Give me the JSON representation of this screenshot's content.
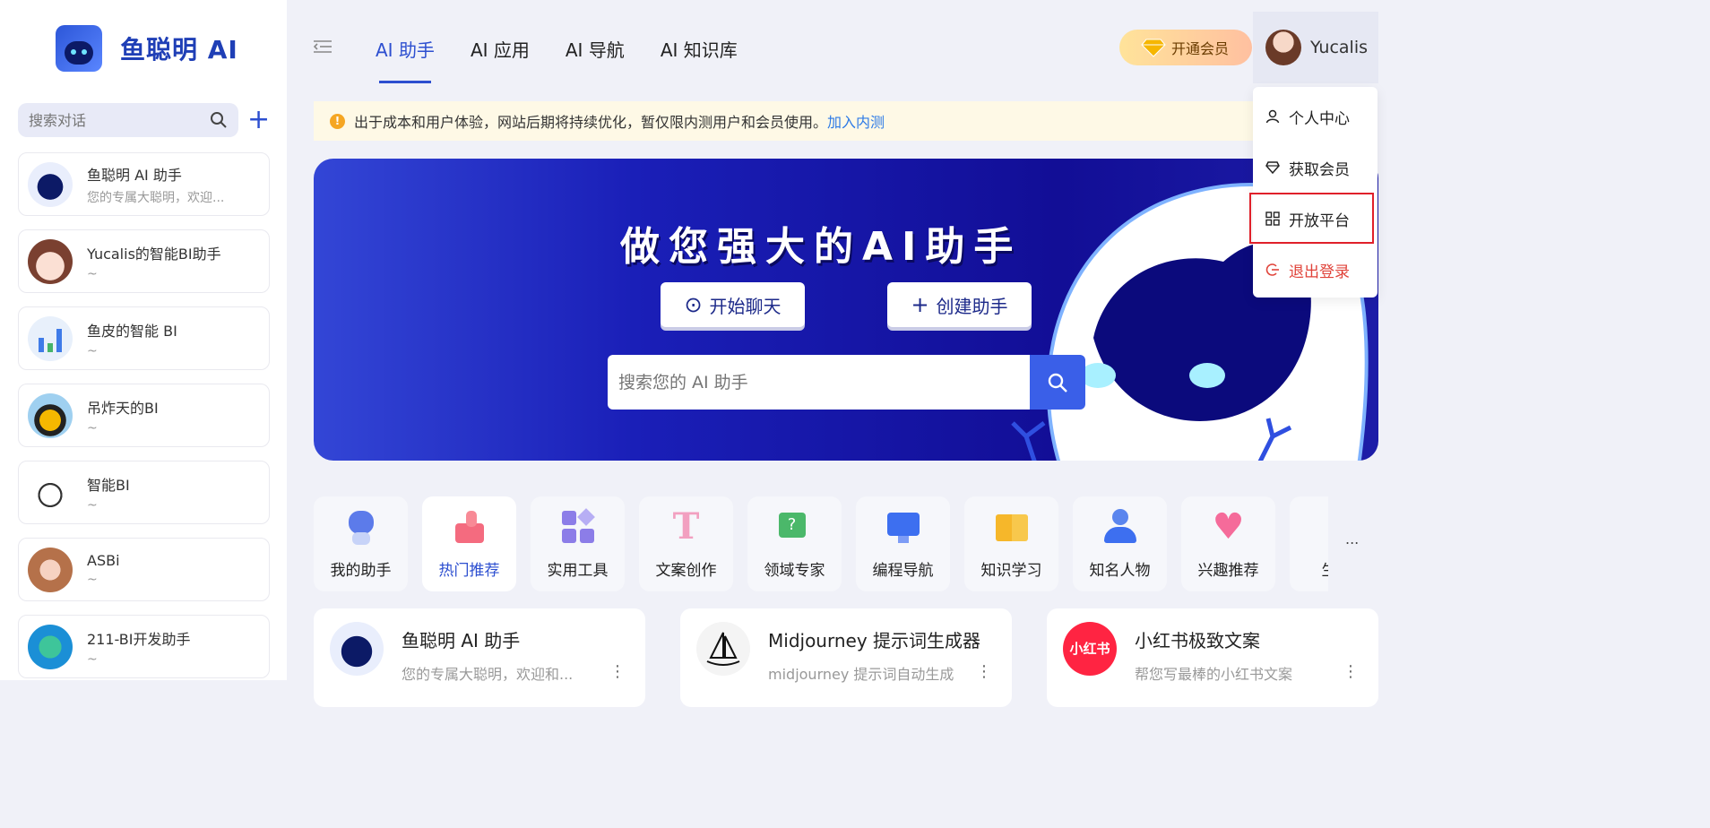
{
  "brand": {
    "name": "鱼聪明 AI"
  },
  "sidebar": {
    "search_placeholder": "搜索对话",
    "add_label": "+",
    "conversations": [
      {
        "title": "鱼聪明 AI 助手",
        "subtitle": "您的专属大聪明，欢迎..."
      },
      {
        "title": "Yucalis的智能BI助手",
        "subtitle": "~"
      },
      {
        "title": "鱼皮的智能 BI",
        "subtitle": "~"
      },
      {
        "title": "吊炸天的BI",
        "subtitle": "~"
      },
      {
        "title": "智能BI",
        "subtitle": "~"
      },
      {
        "title": "ASBi",
        "subtitle": "~"
      },
      {
        "title": "211-BI开发助手",
        "subtitle": "~"
      }
    ]
  },
  "nav": {
    "items": [
      {
        "label": "AI 助手",
        "active": true
      },
      {
        "label": "AI 应用",
        "active": false
      },
      {
        "label": "AI 导航",
        "active": false
      },
      {
        "label": "AI 知识库",
        "active": false
      }
    ]
  },
  "header": {
    "vip_label": "开通会员",
    "user_name": "Yucalis"
  },
  "user_menu": {
    "items": [
      {
        "label": "个人中心",
        "icon": "user-icon"
      },
      {
        "label": "获取会员",
        "icon": "diamond-icon"
      },
      {
        "label": "开放平台",
        "icon": "grid-icon",
        "highlighted": true
      },
      {
        "label": "退出登录",
        "icon": "logout-icon"
      }
    ]
  },
  "notice": {
    "text": "出于成本和用户体验，网站后期将持续优化，暂仅限内测用户和会员使用。",
    "link": "加入内测"
  },
  "banner": {
    "title": "做您强大的AI助手",
    "start_chat": "开始聊天",
    "create_assistant": "创建助手",
    "search_placeholder": "搜索您的 AI 助手"
  },
  "categories": [
    {
      "label": "我的助手",
      "icon": "robot-icon",
      "active": false
    },
    {
      "label": "热门推荐",
      "icon": "thumbs-up-icon",
      "active": true
    },
    {
      "label": "实用工具",
      "icon": "tools-icon",
      "active": false
    },
    {
      "label": "文案创作",
      "icon": "text-icon",
      "active": false
    },
    {
      "label": "领域专家",
      "icon": "question-chat-icon",
      "active": false
    },
    {
      "label": "编程导航",
      "icon": "monitor-gear-icon",
      "active": false
    },
    {
      "label": "知识学习",
      "icon": "book-icon",
      "active": false
    },
    {
      "label": "知名人物",
      "icon": "person-icon",
      "active": false
    },
    {
      "label": "兴趣推荐",
      "icon": "heart-icon",
      "active": false
    },
    {
      "label": "生活",
      "icon": "plant-icon",
      "active": false
    }
  ],
  "more_label": "...",
  "cards": [
    {
      "title": "鱼聪明 AI 助手",
      "desc": "您的专属大聪明，欢迎和...",
      "more": "⋮"
    },
    {
      "title": "Midjourney 提示词生成器",
      "desc": "midjourney 提示词自动生成",
      "more": "⋮"
    },
    {
      "title": "小红书极致文案",
      "desc": "帮您写最棒的小红书文案",
      "more": "⋮",
      "avatar_text": "小红书"
    }
  ],
  "colors": {
    "primary": "#2d4fd0",
    "banner": "#1a1fb8",
    "logout": "#e0433a",
    "highlight": "#e0202a"
  }
}
